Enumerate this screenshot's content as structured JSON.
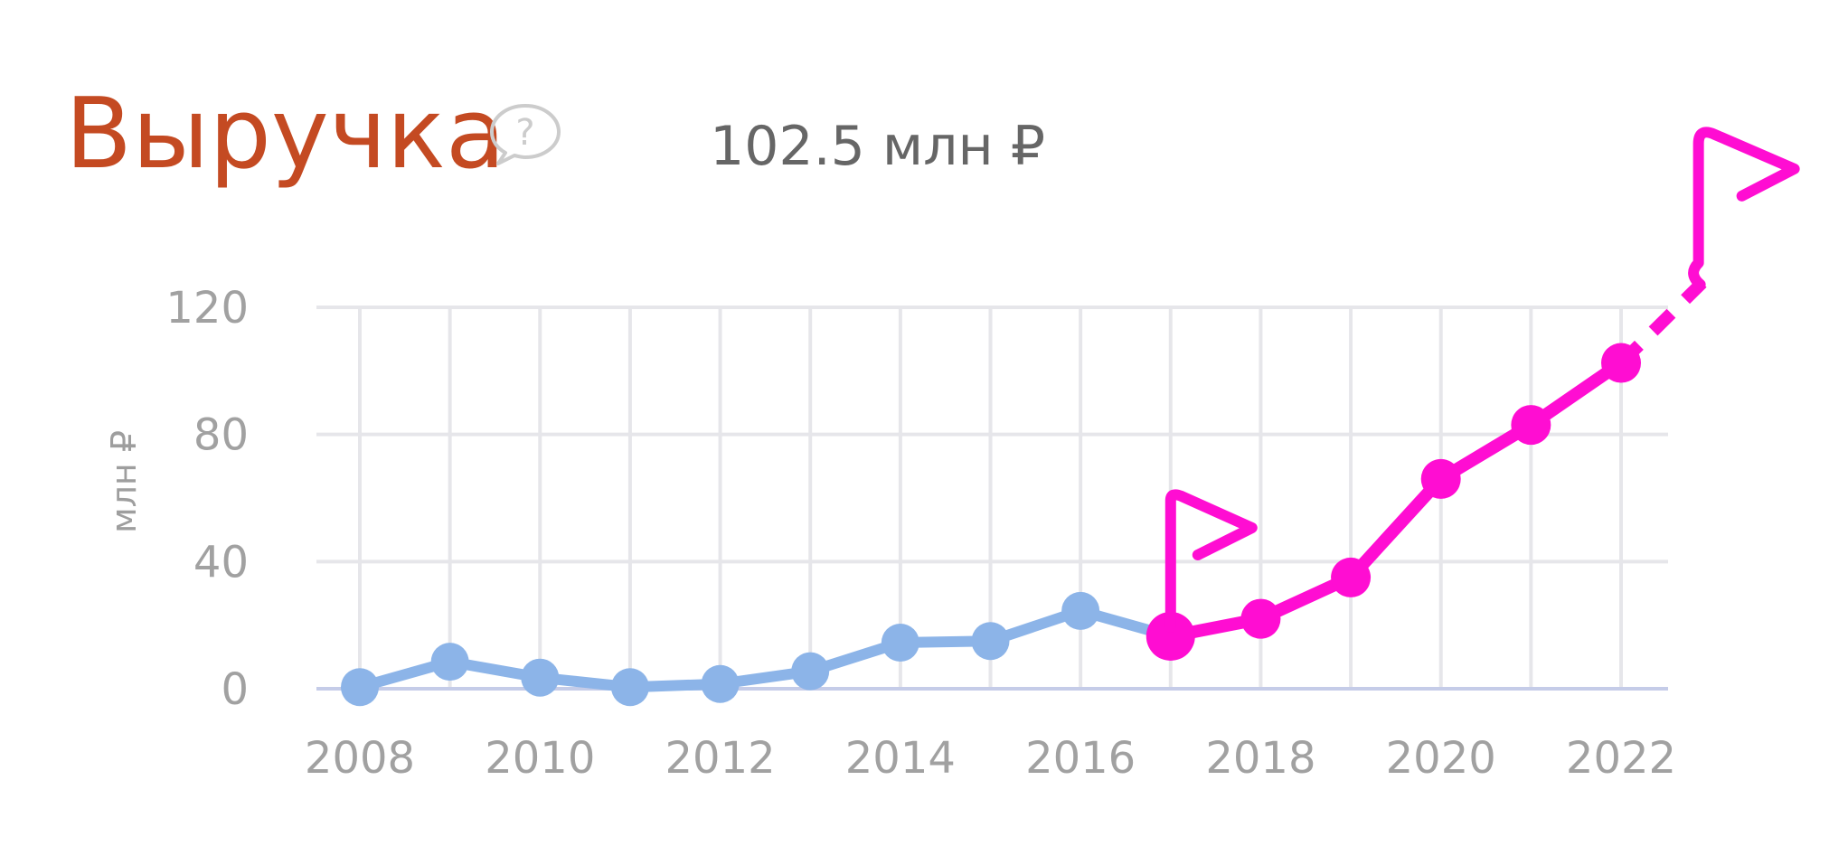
{
  "header": {
    "title": "Выручка",
    "total_value": "102.5 млн ₽"
  },
  "chart_data": {
    "type": "line",
    "title": "Выручка",
    "ylabel": "млн ₽",
    "xlabel": "",
    "ylim": [
      0,
      120
    ],
    "yticks": [
      "0",
      "40",
      "80",
      "120"
    ],
    "xticks": [
      "2008",
      "2010",
      "2012",
      "2014",
      "2016",
      "2018",
      "2020",
      "2022"
    ],
    "x": [
      2008,
      2009,
      2010,
      2011,
      2012,
      2013,
      2014,
      2015,
      2016,
      2017,
      2018,
      2019,
      2020,
      2021,
      2022
    ],
    "values": [
      0.5,
      8.5,
      3.5,
      0.5,
      1.5,
      5.5,
      14.5,
      15,
      24.5,
      16.5,
      22,
      35,
      66,
      83,
      102.5
    ],
    "highlight_from": 2017,
    "projection_x": 2023,
    "projection_value": 130,
    "grid": true,
    "colors": {
      "base_line": "#8cb4e8",
      "highlight_line": "#ff0dd2",
      "grid": "#e6e6ea",
      "baseline_axis": "#c5cce8"
    }
  }
}
